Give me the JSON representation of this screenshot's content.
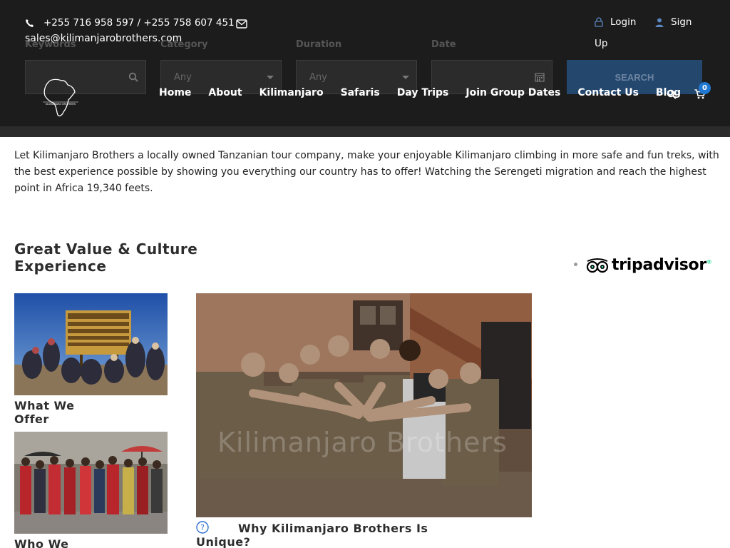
{
  "topbar": {
    "phone": "+255 716 958 597 / +255 758 607 451",
    "email": "sales@kilimanjarobrothers.com",
    "login_label": "Login",
    "signup_label_1": "Sign",
    "signup_label_2": "Up"
  },
  "search_form": {
    "keywords_label": "Keywords",
    "keywords_value": "",
    "category_label": "Category",
    "category_value": "Any",
    "duration_label": "Duration",
    "duration_value": "Any",
    "date_label": "Date",
    "date_value": "",
    "search_button": "SEARCH"
  },
  "nav": {
    "items": [
      "Home",
      "About",
      "Kilimanjaro",
      "Safaris",
      "Day Trips",
      "Join Group Dates",
      "Contact Us",
      "Blog"
    ],
    "cart_count": "0"
  },
  "main": {
    "intro": "Let Kilimanjaro Brothers a locally owned Tanzanian tour company, make your enjoyable Kilimanjaro climbing in more safe and fun treks, with the best experience possible by showing you everything our country has to offer! Watching the Serengeti migration and reach the highest point in Africa 19,340 feets.",
    "section_title": "Great Value & Culture Experience",
    "tripadvisor": "tripadvisor",
    "cards": [
      {
        "title": "What We Offer"
      },
      {
        "title": "Who We"
      }
    ],
    "watermark": "Kilimanjaro Brothers",
    "unique_title_1": "Why Kilimanjaro Brothers Is",
    "unique_title_2": "Unique?"
  },
  "colors": {
    "header_bg": "#1c1c1c",
    "search_button_bg": "#24476e",
    "cart_badge": "#1f78d1",
    "tripadvisor_green": "#34e0a1"
  }
}
